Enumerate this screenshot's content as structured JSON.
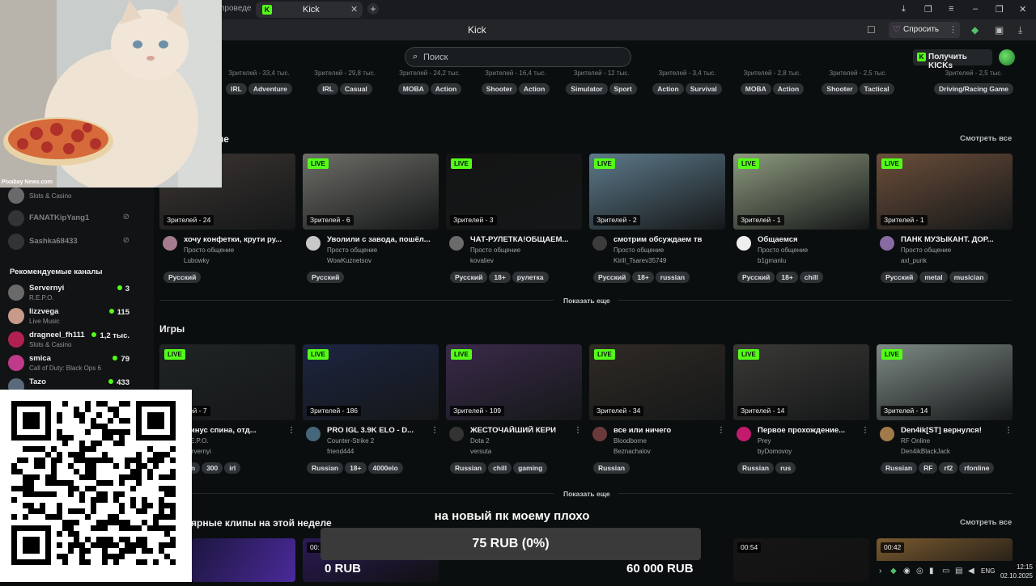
{
  "browser": {
    "prev_tab_label": "проведе",
    "active_tab_label": "Kick",
    "page_title": "Kick",
    "ask_label": "Спросить"
  },
  "header": {
    "search_placeholder": "Поиск",
    "get_kicks_label": "Получить KICKs"
  },
  "categories": [
    {
      "viewers": "Зрителей - 33,4 тыс.",
      "tags": [
        "IRL",
        "Adventure"
      ]
    },
    {
      "viewers": "Зрителей - 29,8 тыс.",
      "tags": [
        "IRL",
        "Casual"
      ]
    },
    {
      "viewers": "Зрителей - 24,2 тыс.",
      "tags": [
        "MOBA",
        "Action"
      ]
    },
    {
      "viewers": "Зрителей - 16,4 тыс.",
      "tags": [
        "Shooter",
        "Action"
      ]
    },
    {
      "viewers": "Зрителей - 12 тыс.",
      "tags": [
        "Simulator",
        "Sport"
      ]
    },
    {
      "viewers": "Зрителей - 3,4 тыс.",
      "tags": [
        "Action",
        "Survival"
      ]
    },
    {
      "viewers": "Зрителей - 2,8 тыс.",
      "tags": [
        "MOBA",
        "Action"
      ]
    },
    {
      "viewers": "Зрителей - 2,5 тыс.",
      "tags": [
        "Shooter",
        "Tactical"
      ]
    },
    {
      "viewers": "Зрителей - 2,5 тыс.",
      "tags": [
        "Driving/Racing Game"
      ]
    }
  ],
  "section1": {
    "title": "ение",
    "see_all": "Смотреть все",
    "show_more": "Показать еще",
    "cards": [
      {
        "live": "LIVE",
        "viewers": "Зрителей - 24",
        "title": "хочу конфетки, крути ру...",
        "category": "Просто общение",
        "user": "Lubowky",
        "tags": [
          "Русский"
        ],
        "bg": "#3b3532",
        "avatar": "#a47b8f"
      },
      {
        "live": "LIVE",
        "viewers": "Зрителей - 6",
        "title": "Уволили с завода, пошёл...",
        "category": "Просто общение",
        "user": "WowKuznetsov",
        "tags": [
          "Русский"
        ],
        "bg": "#6d6e68",
        "avatar": "#c8c8c8"
      },
      {
        "live": "LIVE",
        "viewers": "Зрителей - 3",
        "title": "ЧАТ-РУЛЕТКА!ОБЩАЕМ...",
        "category": "Просто общение",
        "user": "kovaliev",
        "tags": [
          "Русский",
          "18+",
          "рулетка"
        ],
        "bg": "#141414",
        "avatar": "#6b6b6b"
      },
      {
        "live": "LIVE",
        "viewers": "Зрителей - 2",
        "title": "смотрим обсуждаем тв",
        "category": "Просто общение",
        "user": "Kirill_Tsarev35749",
        "tags": [
          "Русский",
          "18+",
          "russian"
        ],
        "bg": "#5d7a8a",
        "avatar": "#3c3c3c"
      },
      {
        "live": "LIVE",
        "viewers": "Зрителей - 1",
        "title": "Общаемся",
        "category": "Просто общение",
        "user": "b1gmanlu",
        "tags": [
          "Русский",
          "18+",
          "chill"
        ],
        "bg": "#8d9a7e",
        "avatar": "#efefef"
      },
      {
        "live": "LIVE",
        "viewers": "Зрителей - 1",
        "title": "ПАНК МУЗЫКАНТ. ДОР...",
        "category": "Просто общение",
        "user": "axl_punk",
        "tags": [
          "Русский",
          "metal",
          "musician"
        ],
        "bg": "#6b4e3a",
        "avatar": "#8a6aa3"
      }
    ]
  },
  "section2": {
    "title": "Игры",
    "show_more": "Показать еще",
    "cards": [
      {
        "live": "LIVE",
        "viewers": "Зрителей - 7",
        "title": "Минус спина, отд...",
        "category": "R.E.P.O.",
        "user": "Servernyi",
        "tags": [
          "Russian",
          "300",
          "irl"
        ],
        "bg": "#202425",
        "avatar": "#555555"
      },
      {
        "live": "LIVE",
        "viewers": "Зрителей - 186",
        "title": "PRO IGL 3.9K ELO - D...",
        "category": "Counter-Strike 2",
        "user": "friend444",
        "tags": [
          "Russian",
          "18+",
          "4000elo"
        ],
        "bg": "#1d2440",
        "avatar": "#46667a"
      },
      {
        "live": "LIVE",
        "viewers": "Зрителей - 109",
        "title": "ЖЕСТОЧАЙШИЙ КЕРИ",
        "category": "Dota 2",
        "user": "versuta",
        "tags": [
          "Russian",
          "chill",
          "gaming"
        ],
        "bg": "#3a2a4a",
        "avatar": "#333333"
      },
      {
        "live": "LIVE",
        "viewers": "Зрителей - 34",
        "title": "все или ничего",
        "category": "Bloodborne",
        "user": "Beznachalov",
        "tags": [
          "Russian"
        ],
        "bg": "#2f2a24",
        "avatar": "#6a3a3a"
      },
      {
        "live": "LIVE",
        "viewers": "Зрителей - 14",
        "title": "Первое прохождение...",
        "category": "Prey",
        "user": "byDomovoy",
        "tags": [
          "Russian",
          "rus"
        ],
        "bg": "#3a3936",
        "avatar": "#c21b6e"
      },
      {
        "live": "LIVE",
        "viewers": "Зрителей - 14",
        "title": "Den4ik[ST] вернулся!",
        "category": "RF Online",
        "user": "Den4ikBlackJack",
        "tags": [
          "Russian",
          "RF",
          "rf2",
          "rfonline"
        ],
        "bg": "#7e8a86",
        "avatar": "#a07a4a"
      }
    ]
  },
  "section3": {
    "title": "ярные клипы на этой неделе",
    "see_all": "Смотреть все",
    "clips": [
      {
        "duration": "00:",
        "bg": "#2a1a55"
      },
      {
        "duration": "00:54",
        "bg": "#161616"
      },
      {
        "duration": "00:42",
        "bg": "#7a5a30"
      }
    ]
  },
  "sidebar": {
    "top_rows": [
      {
        "name": "",
        "category": "Slots & Casino",
        "offline": false
      },
      {
        "name": "FANATKipYang1",
        "category": "",
        "offline": true
      },
      {
        "name": "Sashka68433",
        "category": "",
        "offline": true
      }
    ],
    "recommended_title": "Рекомендуемые каналы",
    "recommended": [
      {
        "name": "Servernyi",
        "category": "R.E.P.O.",
        "count": "3",
        "avatar": "#6a6a6a"
      },
      {
        "name": "lizzvega",
        "category": "Live Music",
        "count": "115",
        "avatar": "#c89a8a"
      },
      {
        "name": "dragneel_fh111",
        "category": "Slots & Casino",
        "count": "1,2 тыс.",
        "avatar": "#b02050"
      },
      {
        "name": "smica",
        "category": "Call of Duty: Black Ops 6",
        "count": "79",
        "avatar": "#c03a8a"
      },
      {
        "name": "Tazo",
        "category": "",
        "count": "433",
        "avatar": "#5a6a7a"
      }
    ]
  },
  "overlay": {
    "watermark": "Pixabay News.com",
    "donation_title": "на новый пк моему плохо",
    "donation_value": "75 RUB (0%)",
    "donation_progress": 0,
    "donation_min": "0 RUB",
    "donation_max": "60 000 RUB"
  },
  "tray": {
    "lang": "ENG",
    "time": "12:15",
    "date": "02.10.2025"
  },
  "colors": {
    "accent": "#53fc18",
    "background": "#0b0e0f"
  }
}
